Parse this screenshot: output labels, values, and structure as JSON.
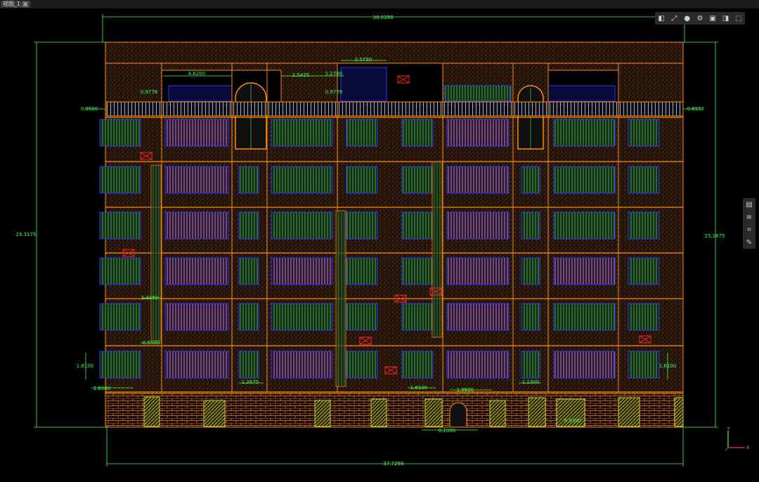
{
  "tab": {
    "label": "视图_1",
    "close": "x"
  },
  "toolbar": {
    "buttons": [
      "layers-icon",
      "fit-icon",
      "shading-icon",
      "settings-icon",
      "cube-front-icon",
      "cube-top-icon",
      "cube-iso-icon"
    ]
  },
  "sidebar": {
    "buttons": [
      "properties-icon",
      "layers-panel-icon",
      "crop-icon",
      "edit-icon"
    ]
  },
  "dimensions": {
    "top_overall": "38.0298",
    "bottom_overall": "37.7298",
    "left_height": "25.3175",
    "right_height": "25.1675",
    "d_4_62": "4.6200",
    "d_2_54": "2.5425",
    "d_1_27": "1.2780",
    "d_2_57": "2.5750",
    "d_0_97a": "0.9778",
    "d_0_97b": "0.9778",
    "d_0_95": "0.9500",
    "d_0_65": "0.6552",
    "d_1_61a": "1.6100",
    "d_1_61b": "1.6100",
    "d_2_80": "2.8000",
    "d_0_55": "0.5500",
    "d_1_33": "1.3350",
    "d_0_10": "0.1000",
    "d_1_26": "1.2675",
    "d_1_61c": "1.6100",
    "d_1_96": "1.9600",
    "d_1_19": "1.1900",
    "d_6_93": "6.9300"
  },
  "ucs": {
    "x": "X",
    "y": "Y"
  },
  "colors": {
    "outline": "#ff8c00",
    "dim": "#3fff3f",
    "window_green": "#3a8a3a",
    "window_purple": "#b77ad6",
    "label_red": "#ff2020",
    "wall": "#2a1608",
    "blue": "#2b35ff"
  }
}
